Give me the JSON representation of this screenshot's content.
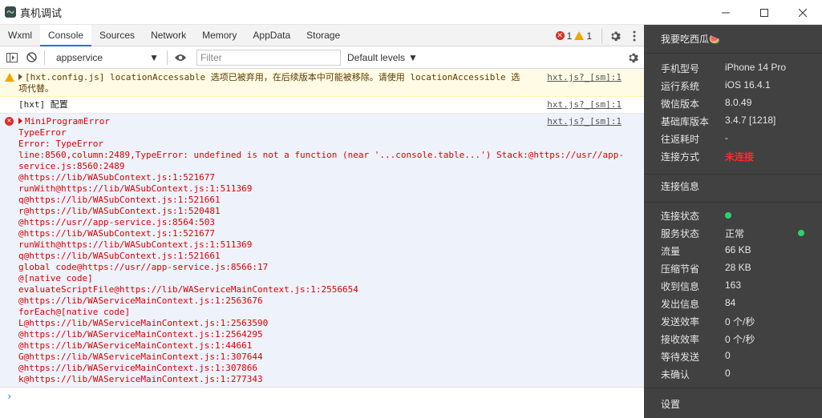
{
  "window": {
    "title": "真机调试",
    "controls": {
      "minimize": "—",
      "maximize": "☐",
      "close": "✕"
    }
  },
  "tabs": [
    "Wxml",
    "Console",
    "Sources",
    "Network",
    "Memory",
    "AppData",
    "Storage"
  ],
  "active_tab": "Console",
  "counts": {
    "errors": "1",
    "warnings": "1"
  },
  "toolbar": {
    "context": "appservice",
    "filter_placeholder": "Filter",
    "levels": "Default levels"
  },
  "console": {
    "warn": {
      "prefix": "[hxt.config.js] locationAccessable ",
      "text_a": "选项已被弃用，在后续版本中可能被移除。请使用",
      "code": " locationAccessible ",
      "text_b": "选",
      "text_c": "项代替。",
      "source": "hxt.js?_[sm]:1"
    },
    "info": {
      "prefix": "[hxt] ",
      "text": "配置",
      "source": "hxt.js?_[sm]:1"
    },
    "error": {
      "head": "MiniProgramError",
      "source": "hxt.js?_[sm]:1",
      "lines": [
        "TypeError",
        "Error: TypeError",
        "line:8560,column:2489,TypeError: undefined is not a function (near '...console.table...') Stack:@https://usr//app-",
        "service.js:8560:2489",
        "@https://lib/WASubContext.js:1:521677",
        "runWith@https://lib/WASubContext.js:1:511369",
        "q@https://lib/WASubContext.js:1:521661",
        "r@https://lib/WASubContext.js:1:520481",
        "@https://usr//app-service.js:8564:503",
        "@https://lib/WASubContext.js:1:521677",
        "runWith@https://lib/WASubContext.js:1:511369",
        "q@https://lib/WASubContext.js:1:521661",
        "global code@https://usr//app-service.js:8566:17",
        "@[native code]",
        "evaluateScriptFile@https://lib/WAServiceMainContext.js:1:2556654",
        "@https://lib/WAServiceMainContext.js:1:2563676",
        "forEach@[native code]",
        "L@https://lib/WAServiceMainContext.js:1:2563590",
        "@https://lib/WAServiceMainContext.js:1:2564295",
        "@https://lib/WAServiceMainContext.js:1:44661",
        "G@https://lib/WAServiceMainContext.js:1:307644",
        "@https://lib/WAServiceMainContext.js:1:307866",
        "k@https://lib/WAServiceMainContext.js:1:277343"
      ]
    },
    "prompt": "›"
  },
  "sidepanel": {
    "header": "我要吃西瓜",
    "header_emoji": "🍉",
    "device_rows": [
      {
        "label": "手机型号",
        "value": "iPhone 14 Pro"
      },
      {
        "label": "运行系统",
        "value": "iOS 16.4.1"
      },
      {
        "label": "微信版本",
        "value": "8.0.49"
      },
      {
        "label": "基础库版本",
        "value": "3.4.7 [1218]"
      },
      {
        "label": "往返耗时",
        "value": "-"
      },
      {
        "label": "连接方式",
        "value": "未连接"
      }
    ],
    "connection_title": "连接信息",
    "stats_rows": [
      {
        "label": "连接状态",
        "value": ""
      },
      {
        "label": "服务状态",
        "value": "正常"
      },
      {
        "label": "流量",
        "value": "66 KB"
      },
      {
        "label": "压缩节省",
        "value": "28 KB"
      },
      {
        "label": "收到信息",
        "value": "163"
      },
      {
        "label": "发出信息",
        "value": "84"
      },
      {
        "label": "发送效率",
        "value": "0 个/秒"
      },
      {
        "label": "接收效率",
        "value": "0 个/秒"
      },
      {
        "label": "等待发送",
        "value": "0"
      },
      {
        "label": "未确认",
        "value": "0"
      }
    ],
    "settings": "设置"
  },
  "colors": {
    "accent": "#1a73e8",
    "error": "#d93025",
    "warning": "#f2a600",
    "panel_bg": "#414141",
    "unconnected": "#ff2a2a",
    "status_green": "#2bd46c"
  }
}
